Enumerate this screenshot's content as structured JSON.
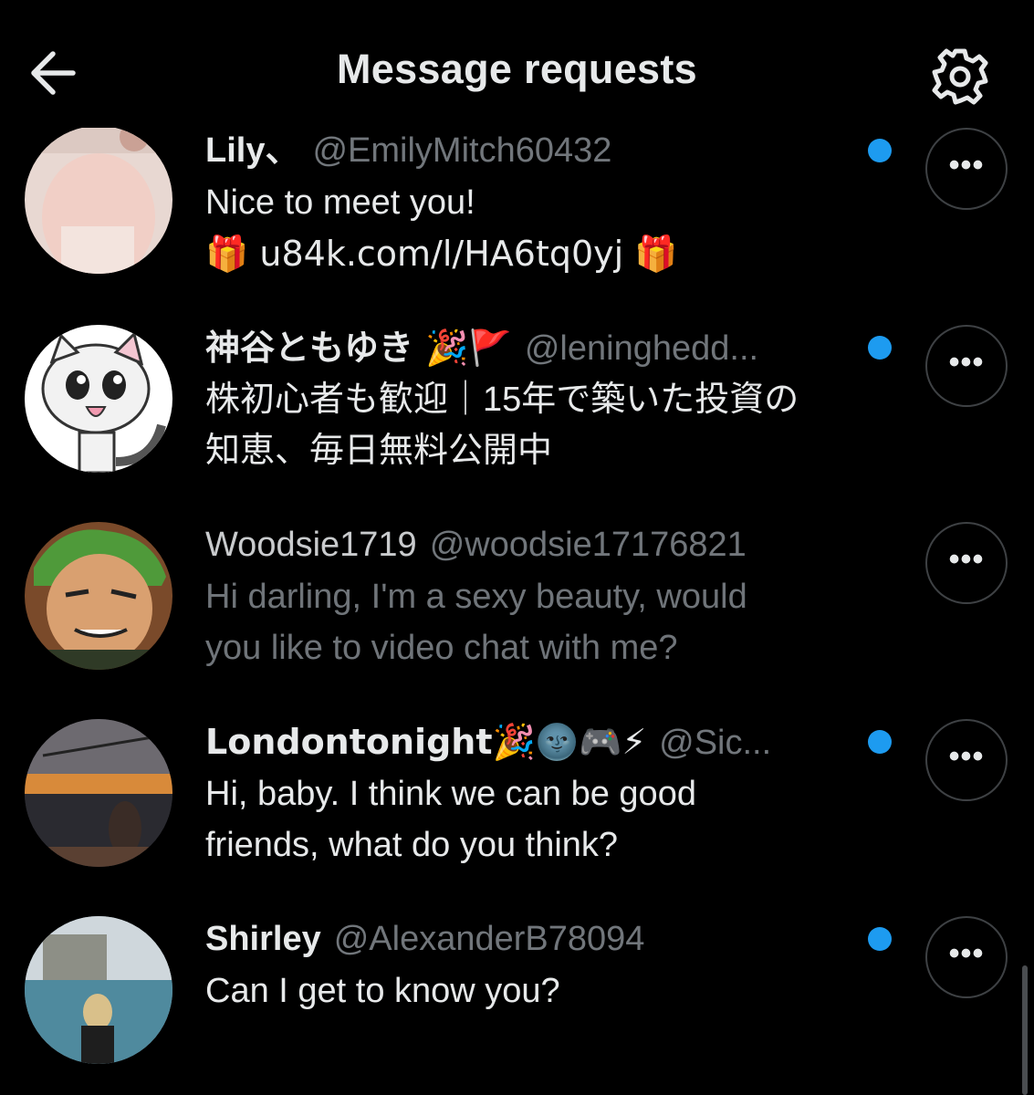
{
  "header": {
    "title": "Message requests",
    "back_icon": "arrow-left-icon",
    "settings_icon": "gear-icon"
  },
  "requests": [
    {
      "display_name": "Lily、",
      "handle": "@EmilyMitch60432",
      "message_line1": "Nice to meet you!",
      "message_line2": "🎁 u84k.com/l/HA6tq0yj 🎁",
      "unread": true,
      "more_label": "•••"
    },
    {
      "display_name": "神谷ともゆき 🎉🚩",
      "handle": "@leninghedd...",
      "message_line1": "株初心者も歓迎｜15年で築いた投資の",
      "message_line2": "知恵、毎日無料公開中",
      "unread": true,
      "more_label": "•••"
    },
    {
      "display_name": "Woodsie1719",
      "handle": "@woodsie17176821",
      "message_line1": "Hi darling, I'm a sexy beauty, would",
      "message_line2": "you like to video chat with me?",
      "unread": false,
      "more_label": "•••"
    },
    {
      "display_name": "Londontonight🎉🌚🎮⚡",
      "handle": "@Sic...",
      "message_line1": "Hi, baby. I think we can be good",
      "message_line2": "friends, what do you think?",
      "unread": true,
      "more_label": "•••"
    },
    {
      "display_name": "Shirley",
      "handle": "@AlexanderB78094",
      "message_line1": "Can I get to know you?",
      "message_line2": "",
      "unread": true,
      "more_label": "•••"
    }
  ],
  "colors": {
    "background": "#000000",
    "unread_dot": "#1d9bf0",
    "handle": "#71767b",
    "text": "#e7e9ea"
  }
}
